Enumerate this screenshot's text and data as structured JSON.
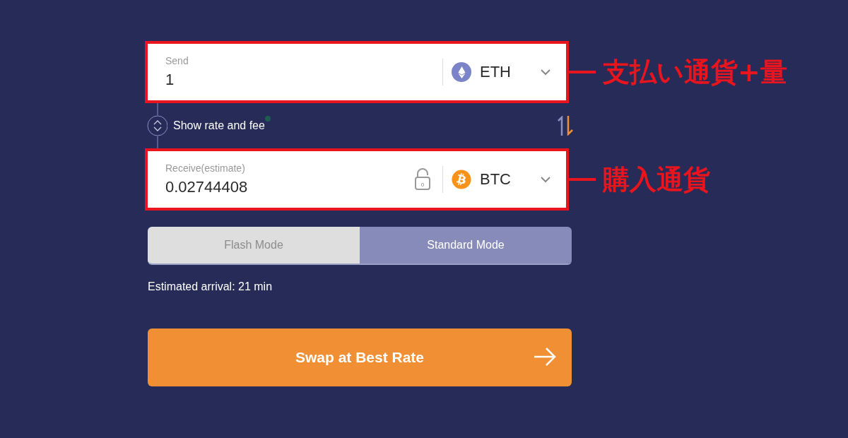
{
  "send": {
    "label": "Send",
    "value": "1",
    "currency": {
      "code": "ETH",
      "kind": "eth"
    },
    "annotation": "支払い通貨+量"
  },
  "rate_toggle": {
    "label": "Show rate and fee"
  },
  "receive": {
    "label": "Receive(estimate)",
    "value": "0.02744408",
    "lock_badge": "0",
    "currency": {
      "code": "BTC",
      "kind": "btc"
    },
    "annotation": "購入通貨"
  },
  "modes": [
    {
      "label": "Flash Mode",
      "selected": false
    },
    {
      "label": "Standard Mode",
      "selected": true
    }
  ],
  "arrival": "Estimated arrival: 21 min",
  "submit": {
    "label": "Swap at Best Rate"
  }
}
